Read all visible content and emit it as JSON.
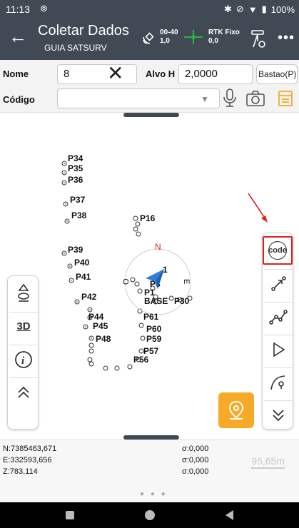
{
  "status": {
    "time": "11:13",
    "battery": "100%"
  },
  "header": {
    "title": "Coletar Dados",
    "subtitle": "GUIA SATSURV",
    "sat_top": "00-40",
    "sat_bottom": "1,0",
    "rtk_top": "RTK Fixo",
    "rtk_bottom": "0,0",
    "more": "•••"
  },
  "form": {
    "nome_label": "Nome",
    "nome_value": "8",
    "alvo_label": "Alvo H",
    "alvo_value": "2,0000",
    "bastao_label": "Bastao(P)",
    "codigo_label": "Código",
    "codigo_value": ""
  },
  "map": {
    "compass_n": "N",
    "compass_e": "E",
    "compass_o": "O",
    "points": [
      "P34",
      "P35",
      "P36",
      "P37",
      "P38",
      "P39",
      "P40",
      "P41",
      "P42",
      "P44",
      "P45",
      "P48",
      "P16",
      "1",
      "P3",
      "P1",
      "BASE",
      "P30",
      "P61",
      "P60",
      "P59",
      "P57",
      "P56"
    ],
    "scale": "95,65m"
  },
  "right_tools": {
    "code_label": "code"
  },
  "left_tools": {
    "3d_label": "3D"
  },
  "coords": {
    "n": "N:7385463,671",
    "e": "E:332593,656",
    "z": "Z:783,114",
    "sn": "σ:0,000",
    "se": "σ:0,000",
    "sz": "σ:0,000"
  },
  "colors": {
    "bar": "#414a54",
    "accent": "#f7a928",
    "highlight": "#e02020",
    "nav_arrow": "#2f7fd6"
  }
}
